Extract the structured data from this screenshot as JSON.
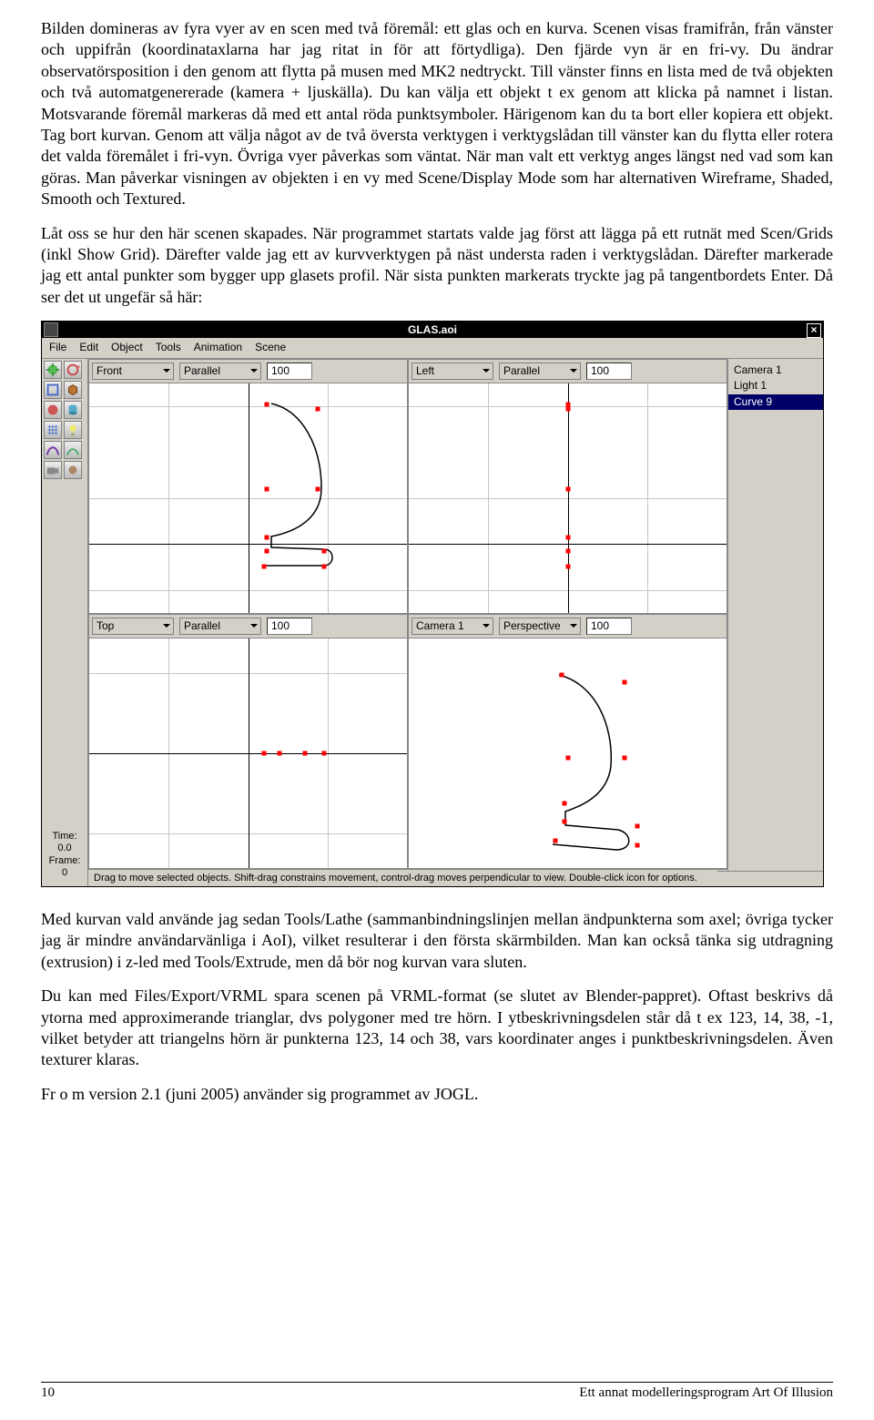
{
  "para1": "Bilden domineras av fyra vyer av en scen med två föremål: ett glas och en kurva. Scenen visas framifrån, från vänster och uppifrån (koordinataxlarna har jag ritat in för att förtydliga). Den fjärde vyn är en fri-vy. Du ändrar observatörsposition i den genom att flytta på musen med MK2 nedtryckt. Till vänster finns en lista med de två objekten och två automatgenererade (kamera + ljuskälla). Du kan välja ett objekt t ex genom att klicka på namnet i listan. Motsvarande föremål markeras då med ett antal röda punktsymboler. Härigenom kan du ta bort eller kopiera ett objekt. Tag bort kurvan. Genom att välja något av de två översta verktygen i verktygslådan till vänster kan du flytta eller rotera det valda föremålet i fri-vyn. Övriga vyer påverkas som väntat. När man valt ett verktyg anges längst ned vad som kan göras. Man påverkar visningen av objekten i en vy med Scene/Display Mode som har alternativen Wireframe, Shaded, Smooth och Textured.",
  "para2": "Låt oss se hur den här scenen skapades. När programmet startats valde jag först att lägga på ett rutnät med Scen/Grids (inkl Show Grid). Därefter valde jag ett av kurvverktygen på näst understa raden i verktygslådan. Därefter markerade jag ett antal punkter som bygger upp glasets profil. När sista punkten markerats tryckte jag på tangentbordets Enter. Då ser det ut ungefär så här:",
  "para3": "Med kurvan vald använde jag sedan Tools/Lathe (sammanbindningslinjen mellan ändpunkterna som axel; övriga tycker jag är mindre användarvänliga i AoI), vilket resulterar i den första skärmbilden. Man kan också tänka sig utdragning (extrusion) i z-led med Tools/Extrude, men då bör nog kurvan vara sluten.",
  "para4": "Du kan med Files/Export/VRML spara scenen på VRML-format (se slutet av Blender-pappret). Oftast beskrivs då ytorna med approximerande trianglar, dvs polygoner med tre hörn. I ytbeskrivningsdelen står då t ex 123, 14, 38, -1, vilket betyder att triangelns hörn är punkterna 123, 14 och 38, vars koordinater anges i punktbeskrivningsdelen. Även texturer klaras.",
  "para5": "Fr o m version 2.1 (juni 2005) använder sig programmet av JOGL.",
  "footer": {
    "page": "10",
    "title": "Ett annat modelleringsprogram Art Of Illusion"
  },
  "app": {
    "title": "GLAS.aoi",
    "menu": [
      "File",
      "Edit",
      "Object",
      "Tools",
      "Animation",
      "Scene"
    ],
    "viewports": [
      {
        "view": "Front",
        "proj": "Parallel",
        "zoom": "100"
      },
      {
        "view": "Left",
        "proj": "Parallel",
        "zoom": "100"
      },
      {
        "view": "Top",
        "proj": "Parallel",
        "zoom": "100"
      },
      {
        "view": "Camera 1",
        "proj": "Perspective",
        "zoom": "100"
      }
    ],
    "objects": [
      "Camera 1",
      "Light 1",
      "Curve 9"
    ],
    "selected_object": 2,
    "time": {
      "label": "Time:",
      "value": "0.0",
      "frame_label": "Frame:",
      "frame_value": "0"
    },
    "status_left": "Drag to move selected objects. Shift-drag constrains movement, control-drag moves perpendicular to view. Double-click icon for options.",
    "status_right": ""
  }
}
